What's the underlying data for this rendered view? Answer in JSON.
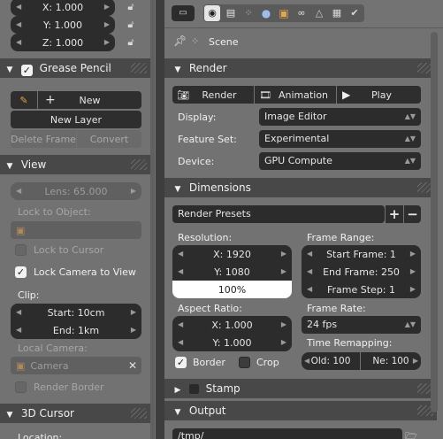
{
  "left": {
    "location": {
      "x": "X: 1.000",
      "y": "Y: 1.000",
      "z": "Z: 1.000"
    },
    "grease_pencil": {
      "title": "Grease Pencil",
      "new_label": "New",
      "new_layer_label": "New Layer",
      "delete_frame_label": "Delete Frame",
      "convert_label": "Convert"
    },
    "view": {
      "title": "View",
      "lens": "Lens: 65.000",
      "lock_to_object_label": "Lock to Object:",
      "lock_to_cursor_label": "Lock to Cursor",
      "lock_camera_label": "Lock Camera to View",
      "clip_label": "Clip:",
      "clip_start": "Start: 10cm",
      "clip_end": "End: 1km",
      "local_camera_label": "Local Camera:",
      "local_camera_value": "Camera",
      "render_border_label": "Render Border"
    },
    "cursor": {
      "title": "3D Cursor",
      "location_label": "Location:"
    }
  },
  "right": {
    "context": {
      "scene_label": "Scene"
    },
    "render": {
      "title": "Render",
      "render_button": "Render",
      "animation_button": "Animation",
      "play_button": "Play",
      "display_label": "Display:",
      "display_value": "Image Editor",
      "feature_set_label": "Feature Set:",
      "feature_set_value": "Experimental",
      "device_label": "Device:",
      "device_value": "GPU Compute"
    },
    "dimensions": {
      "title": "Dimensions",
      "presets_label": "Render Presets",
      "resolution_label": "Resolution:",
      "res_x": "X: 1920",
      "res_y": "Y: 1080",
      "res_pct": "100%",
      "frame_range_label": "Frame Range:",
      "start_frame": "Start Frame: 1",
      "end_frame": "End Frame: 250",
      "frame_step": "Frame Step: 1",
      "aspect_label": "Aspect Ratio:",
      "aspect_x": "X: 1.000",
      "aspect_y": "Y: 1.000",
      "frame_rate_label": "Frame Rate:",
      "frame_rate_value": "24 fps",
      "border_label": "Border",
      "crop_label": "Crop",
      "time_remap_label": "Time Remapping:",
      "remap_old": "Old: 100",
      "remap_new": "Ne: 100"
    },
    "stamp": {
      "title": "Stamp"
    },
    "output": {
      "title": "Output",
      "path": "/tmp/"
    }
  }
}
